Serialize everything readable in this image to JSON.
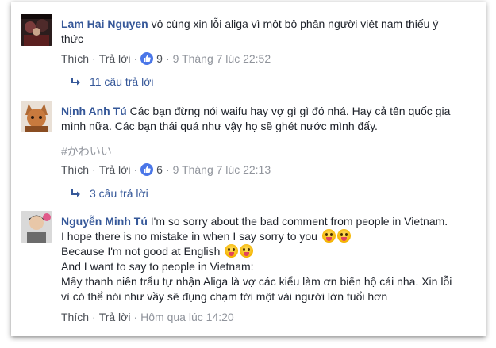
{
  "comments": [
    {
      "author": "Lam Hai Nguyen",
      "lines": [
        "vô cùng xin lỗi aliga vì một bộ phận người việt nam thiếu ý",
        "thức"
      ],
      "like_label": "Thích",
      "reply_label": "Trả lời",
      "likes": "9",
      "timestamp": "9 Tháng 7 lúc 22:52",
      "replies": "11 câu trả lời"
    },
    {
      "author": "Nịnh Anh Tú",
      "lines": [
        "Các bạn đừng nói waifu hay vợ gì gì đó nhá. Hay cả tên quốc gia",
        "mình nữa. Các bạn thái quá như vậy họ sẽ ghét nước mình đấy."
      ],
      "hashtag": "#かわいい",
      "like_label": "Thích",
      "reply_label": "Trả lời",
      "likes": "6",
      "timestamp": "9 Tháng 7 lúc 22:13",
      "replies": "3 câu trả lời"
    },
    {
      "author": "Nguyễn Minh Tú",
      "lines": [
        "I'm so sorry about the bad comment from people in Vietnam.",
        "I hope there is no mistake in when I say sorry to you",
        "Because I'm not good at English",
        "And I want to say to people in Vietnam:",
        "Mấy thanh niên trẩu tự nhận Aliga là vợ các kiểu làm ơn biến hộ cái nha. Xin lỗi",
        "vì có thể nói như vầy sẽ đụng chạm tới một vài người lớn tuổi hơn"
      ],
      "like_label": "Thích",
      "reply_label": "Trả lời",
      "timestamp": "Hôm qua lúc 14:20"
    }
  ],
  "colors": {
    "author": "#365899",
    "text": "#1d2129",
    "meta": "#90949c",
    "like_badge": "#4a76e8"
  },
  "icons": [
    "avatar",
    "like-thumb-icon",
    "reply-arrow-icon",
    "tongue-emoji-icon"
  ]
}
